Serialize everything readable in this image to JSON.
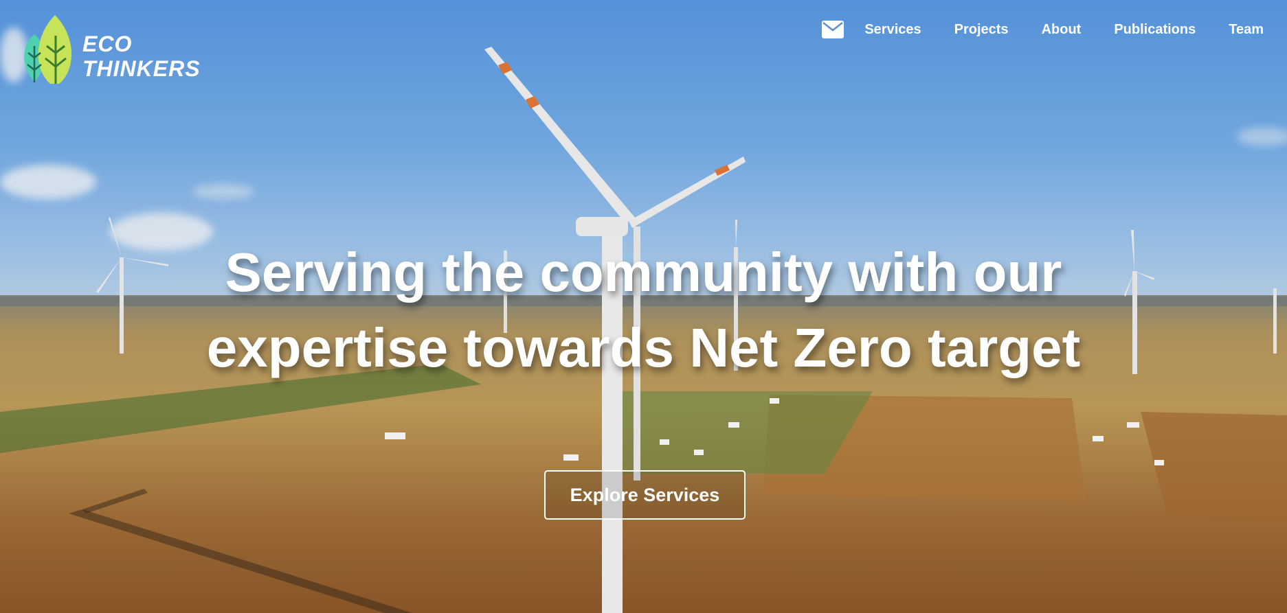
{
  "brand": {
    "line1": "ECO",
    "line2": "THINKERS"
  },
  "nav": {
    "items": [
      "Services",
      "Projects",
      "About",
      "Publications",
      "Team"
    ]
  },
  "hero": {
    "headline_line1": "Serving the community with our",
    "headline_line2": "expertise towards Net Zero target",
    "cta_label": "Explore Services"
  },
  "colors": {
    "leaf_light": "#c6e35a",
    "leaf_teal": "#4fd1b0",
    "text": "#ffffff"
  }
}
